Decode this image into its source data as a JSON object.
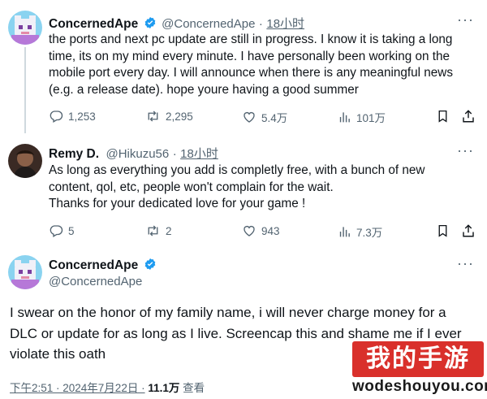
{
  "tweets": [
    {
      "name": "ConcernedApe",
      "handle": "@ConcernedApe",
      "sep": "·",
      "time": "18小时",
      "text_lines": [
        "the ports and next pc update are still in progress. I know it is taking a long",
        "time, its on my mind every minute. I have personally been working on the",
        "mobile port every day. I will announce when there is any meaningful news",
        "(e.g. a release date). hope youre having a good summer"
      ],
      "replies": "1,253",
      "retweets": "2,295",
      "likes": "5.4万",
      "views": "101万"
    },
    {
      "name": "Remy D.",
      "handle": "@Hikuzu56",
      "sep": "·",
      "time": "18小时",
      "text_lines": [
        "As long as everything you add is completly free, with a bunch of new",
        "content, qol, etc, people won't complain for the wait.",
        "Thanks for your dedicated love for your game !"
      ],
      "replies": "5",
      "retweets": "2",
      "likes": "943",
      "views": "7.3万"
    }
  ],
  "main_tweet": {
    "name": "ConcernedApe",
    "handle": "@ConcernedApe",
    "text_lines": [
      "I swear on the honor of my family name,  i will never charge money for a",
      "DLC or update for as long as I live. Screencap this and shame me if I ever",
      "violate this oath"
    ],
    "time": "下午2:51 · 2024年7月22日 ·",
    "views_count": "11.1万",
    "views_label": "查看"
  },
  "more_label": "···",
  "watermark": {
    "title": "我的手游",
    "url": "wodeshouyou.com"
  },
  "colors": {
    "verified": "#1d9bf0",
    "muted": "#536471",
    "text": "#0f1419",
    "watermark_red": "#d9302b"
  },
  "icons": [
    "verified-badge-icon",
    "reply-icon",
    "retweet-icon",
    "like-icon",
    "views-icon",
    "bookmark-icon",
    "share-icon",
    "more-icon"
  ]
}
